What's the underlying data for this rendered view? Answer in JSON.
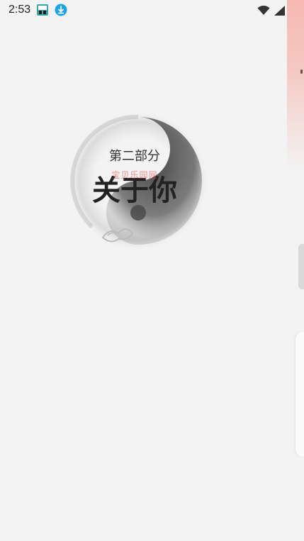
{
  "status_bar": {
    "time": "2:53",
    "icons": [
      "app-notification-icon",
      "download-icon",
      "wifi-icon",
      "signal-icon",
      "battery-icon"
    ]
  },
  "section": {
    "kicker": "第二部分",
    "title": "关于你",
    "watermark": "宝贝乐园网"
  },
  "colors": {
    "background": "#f3f3f3",
    "download_icon": "#1aa3e8",
    "edge_accent": "#f6b9b1"
  }
}
